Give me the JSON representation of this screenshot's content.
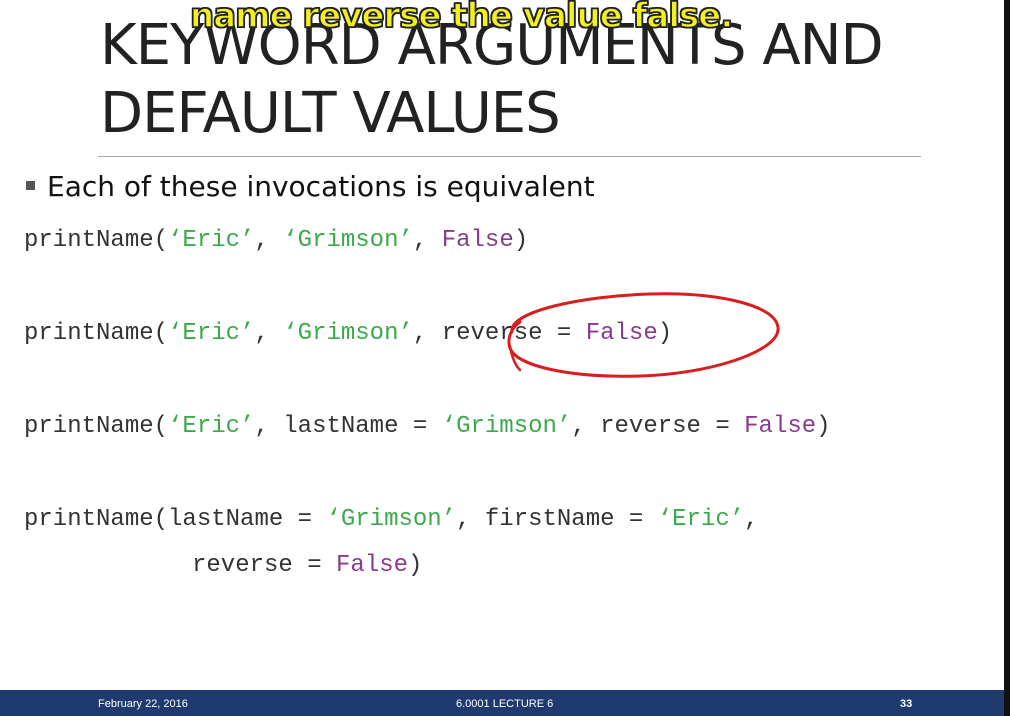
{
  "caption": "name reverse the value false.",
  "slide": {
    "title_line_1": "KEYWORD ARGUMENTS AND",
    "title_line_2": "DEFAULT VALUES",
    "bullet": "Each of these invocations is equivalent"
  },
  "code": {
    "line1": {
      "p1": "printName(",
      "s1": "‘Eric’",
      "p2": ", ",
      "s2": "‘Grimson’",
      "p3": ", ",
      "k1": "False",
      "p4": ")"
    },
    "line2": {
      "p1": "printName(",
      "s1": "‘Eric’",
      "p2": ", ",
      "s2": "‘Grimson’",
      "p3": ", reverse = ",
      "k1": "False",
      "p4": ")"
    },
    "line3": {
      "p1": "printName(",
      "s1": "‘Eric’",
      "p2": ", lastName = ",
      "s2": "‘Grimson’",
      "p3": ", reverse = ",
      "k1": "False",
      "p4": ")"
    },
    "line4": {
      "p1": "printName(lastName = ",
      "s1": "‘Grimson’",
      "p2": ", firstName = ",
      "s2": "‘Eric’",
      "p3": ","
    },
    "line5": {
      "p1": "reverse = ",
      "k1": "False",
      "p2": ")"
    }
  },
  "footer": {
    "date": "February 22, 2016",
    "course": "6.0001 LECTURE 6",
    "page": "33"
  },
  "colors": {
    "string": "#3aaa4a",
    "keyword": "#8a3a8e",
    "footer_bar": "#1f3a6e",
    "annotation": "#d81e1e",
    "caption": "#f3f020"
  }
}
